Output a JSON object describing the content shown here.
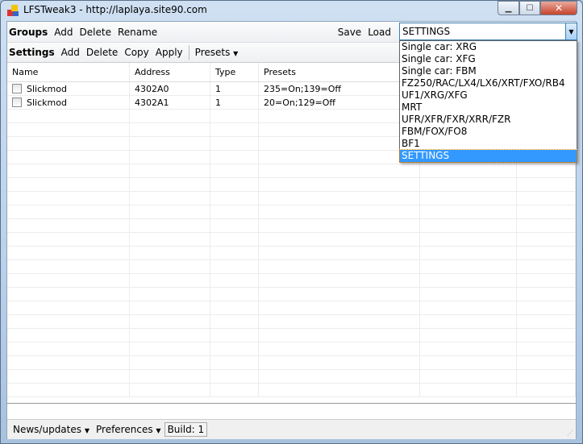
{
  "window": {
    "title": "LFSTweak3 - http://laplaya.site90.com"
  },
  "groups_toolbar": {
    "label": "Groups",
    "add": "Add",
    "delete": "Delete",
    "rename": "Rename",
    "save": "Save",
    "load": "Load",
    "combo_value": "SETTINGS"
  },
  "settings_toolbar": {
    "label": "Settings",
    "add": "Add",
    "delete": "Delete",
    "copy": "Copy",
    "apply": "Apply",
    "presets": "Presets"
  },
  "dropdown": {
    "options": [
      "Single car: XRG",
      "Single car: XFG",
      "Single car: FBM",
      "FZ250/RAC/LX4/LX6/XRT/FXO/RB4",
      "UF1/XRG/XFG",
      "MRT",
      "UFR/XFR/FXR/XRR/FZR",
      "FBM/FOX/FO8",
      "BF1",
      "SETTINGS"
    ],
    "selected": "SETTINGS"
  },
  "table": {
    "columns": [
      "Name",
      "Address",
      "Type",
      "Presets",
      "",
      ""
    ],
    "rows": [
      {
        "checked": false,
        "name": "Slickmod",
        "address": "4302A0",
        "type": "1",
        "presets": "235=On;139=Off"
      },
      {
        "checked": false,
        "name": "Slickmod",
        "address": "4302A1",
        "type": "1",
        "presets": "20=On;129=Off"
      }
    ]
  },
  "statusbar": {
    "news": "News/updates",
    "preferences": "Preferences",
    "build": "Build: 1"
  }
}
